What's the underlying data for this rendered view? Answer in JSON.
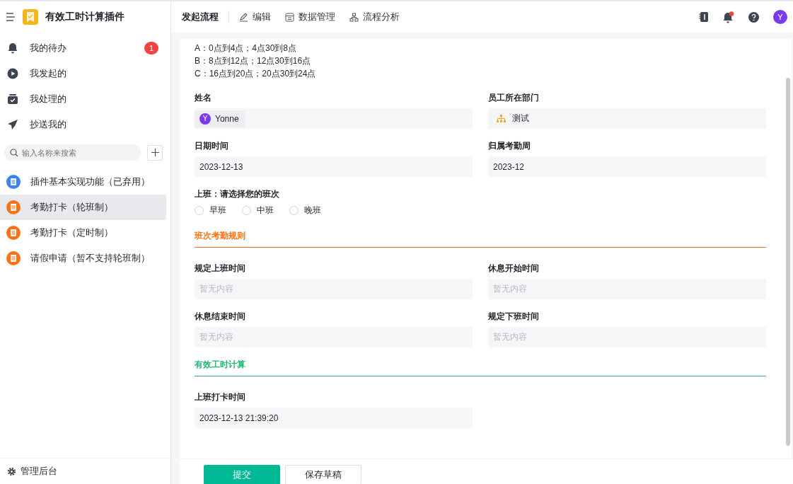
{
  "app": {
    "title": "有效工时计算插件"
  },
  "nav": [
    {
      "label": "我的待办",
      "badge": "1"
    },
    {
      "label": "我发起的"
    },
    {
      "label": "我处理的"
    },
    {
      "label": "抄送我的"
    }
  ],
  "search": {
    "placeholder": "输入名称来搜索"
  },
  "apps": [
    {
      "label": "插件基本实现功能（已弃用）",
      "color": "#3b82f6",
      "selected": false
    },
    {
      "label": "考勤打卡（轮班制）",
      "color": "#f97316",
      "selected": true
    },
    {
      "label": "考勤打卡（定时制）",
      "color": "#f97316",
      "selected": false
    },
    {
      "label": "请假申请（暂不支持轮班制）",
      "color": "#f97316",
      "selected": false
    }
  ],
  "admin": {
    "label": "管理后台"
  },
  "toolbar": [
    {
      "label": "发起流程"
    },
    {
      "label": "编辑"
    },
    {
      "label": "数据管理"
    },
    {
      "label": "流程分析"
    }
  ],
  "notifications": {
    "unread": true
  },
  "user": {
    "initial": "Y"
  },
  "notes": [
    "A：0点到4点；4点30到8点",
    "B：8点到12点；12点30到16点",
    "C：16点到20点；20点30到24点"
  ],
  "form": [
    {
      "kind": "pair",
      "fields": [
        {
          "label": "姓名",
          "kind": "person",
          "value": "Yonne",
          "initial": "Y"
        },
        {
          "label": "员工所在部门",
          "kind": "department",
          "value": "测试"
        }
      ]
    },
    {
      "kind": "pair",
      "fields": [
        {
          "label": "日期时间",
          "kind": "text",
          "value": "2023-12-13"
        },
        {
          "label": "归属考勤周",
          "kind": "text",
          "value": "2023-12"
        }
      ]
    },
    {
      "kind": "radio",
      "label": "上班：请选择您的班次",
      "options": [
        {
          "label": "早班",
          "selected": false
        },
        {
          "label": "中班",
          "selected": false
        },
        {
          "label": "晚班",
          "selected": false
        }
      ]
    },
    {
      "kind": "section",
      "title": "班次考勤规则",
      "color": "#f97316"
    },
    {
      "kind": "pair",
      "fields": [
        {
          "label": "规定上班时间",
          "kind": "empty",
          "placeholder": "暂无内容"
        },
        {
          "label": "休息开始时间",
          "kind": "empty",
          "placeholder": "暂无内容"
        }
      ]
    },
    {
      "kind": "pair",
      "fields": [
        {
          "label": "休息结束时间",
          "kind": "empty",
          "placeholder": "暂无内容"
        },
        {
          "label": "规定下班时间",
          "kind": "empty",
          "placeholder": "暂无内容"
        }
      ]
    },
    {
      "kind": "section",
      "title": "有效工时计算",
      "color": "#22b573"
    },
    {
      "kind": "pair",
      "fields": [
        {
          "label": "上班打卡时间",
          "kind": "text",
          "value": "2023-12-13 21:39:20"
        }
      ]
    }
  ],
  "actions": [
    {
      "label": "提交",
      "primary": true
    },
    {
      "label": "保存草稿",
      "primary": false
    }
  ]
}
